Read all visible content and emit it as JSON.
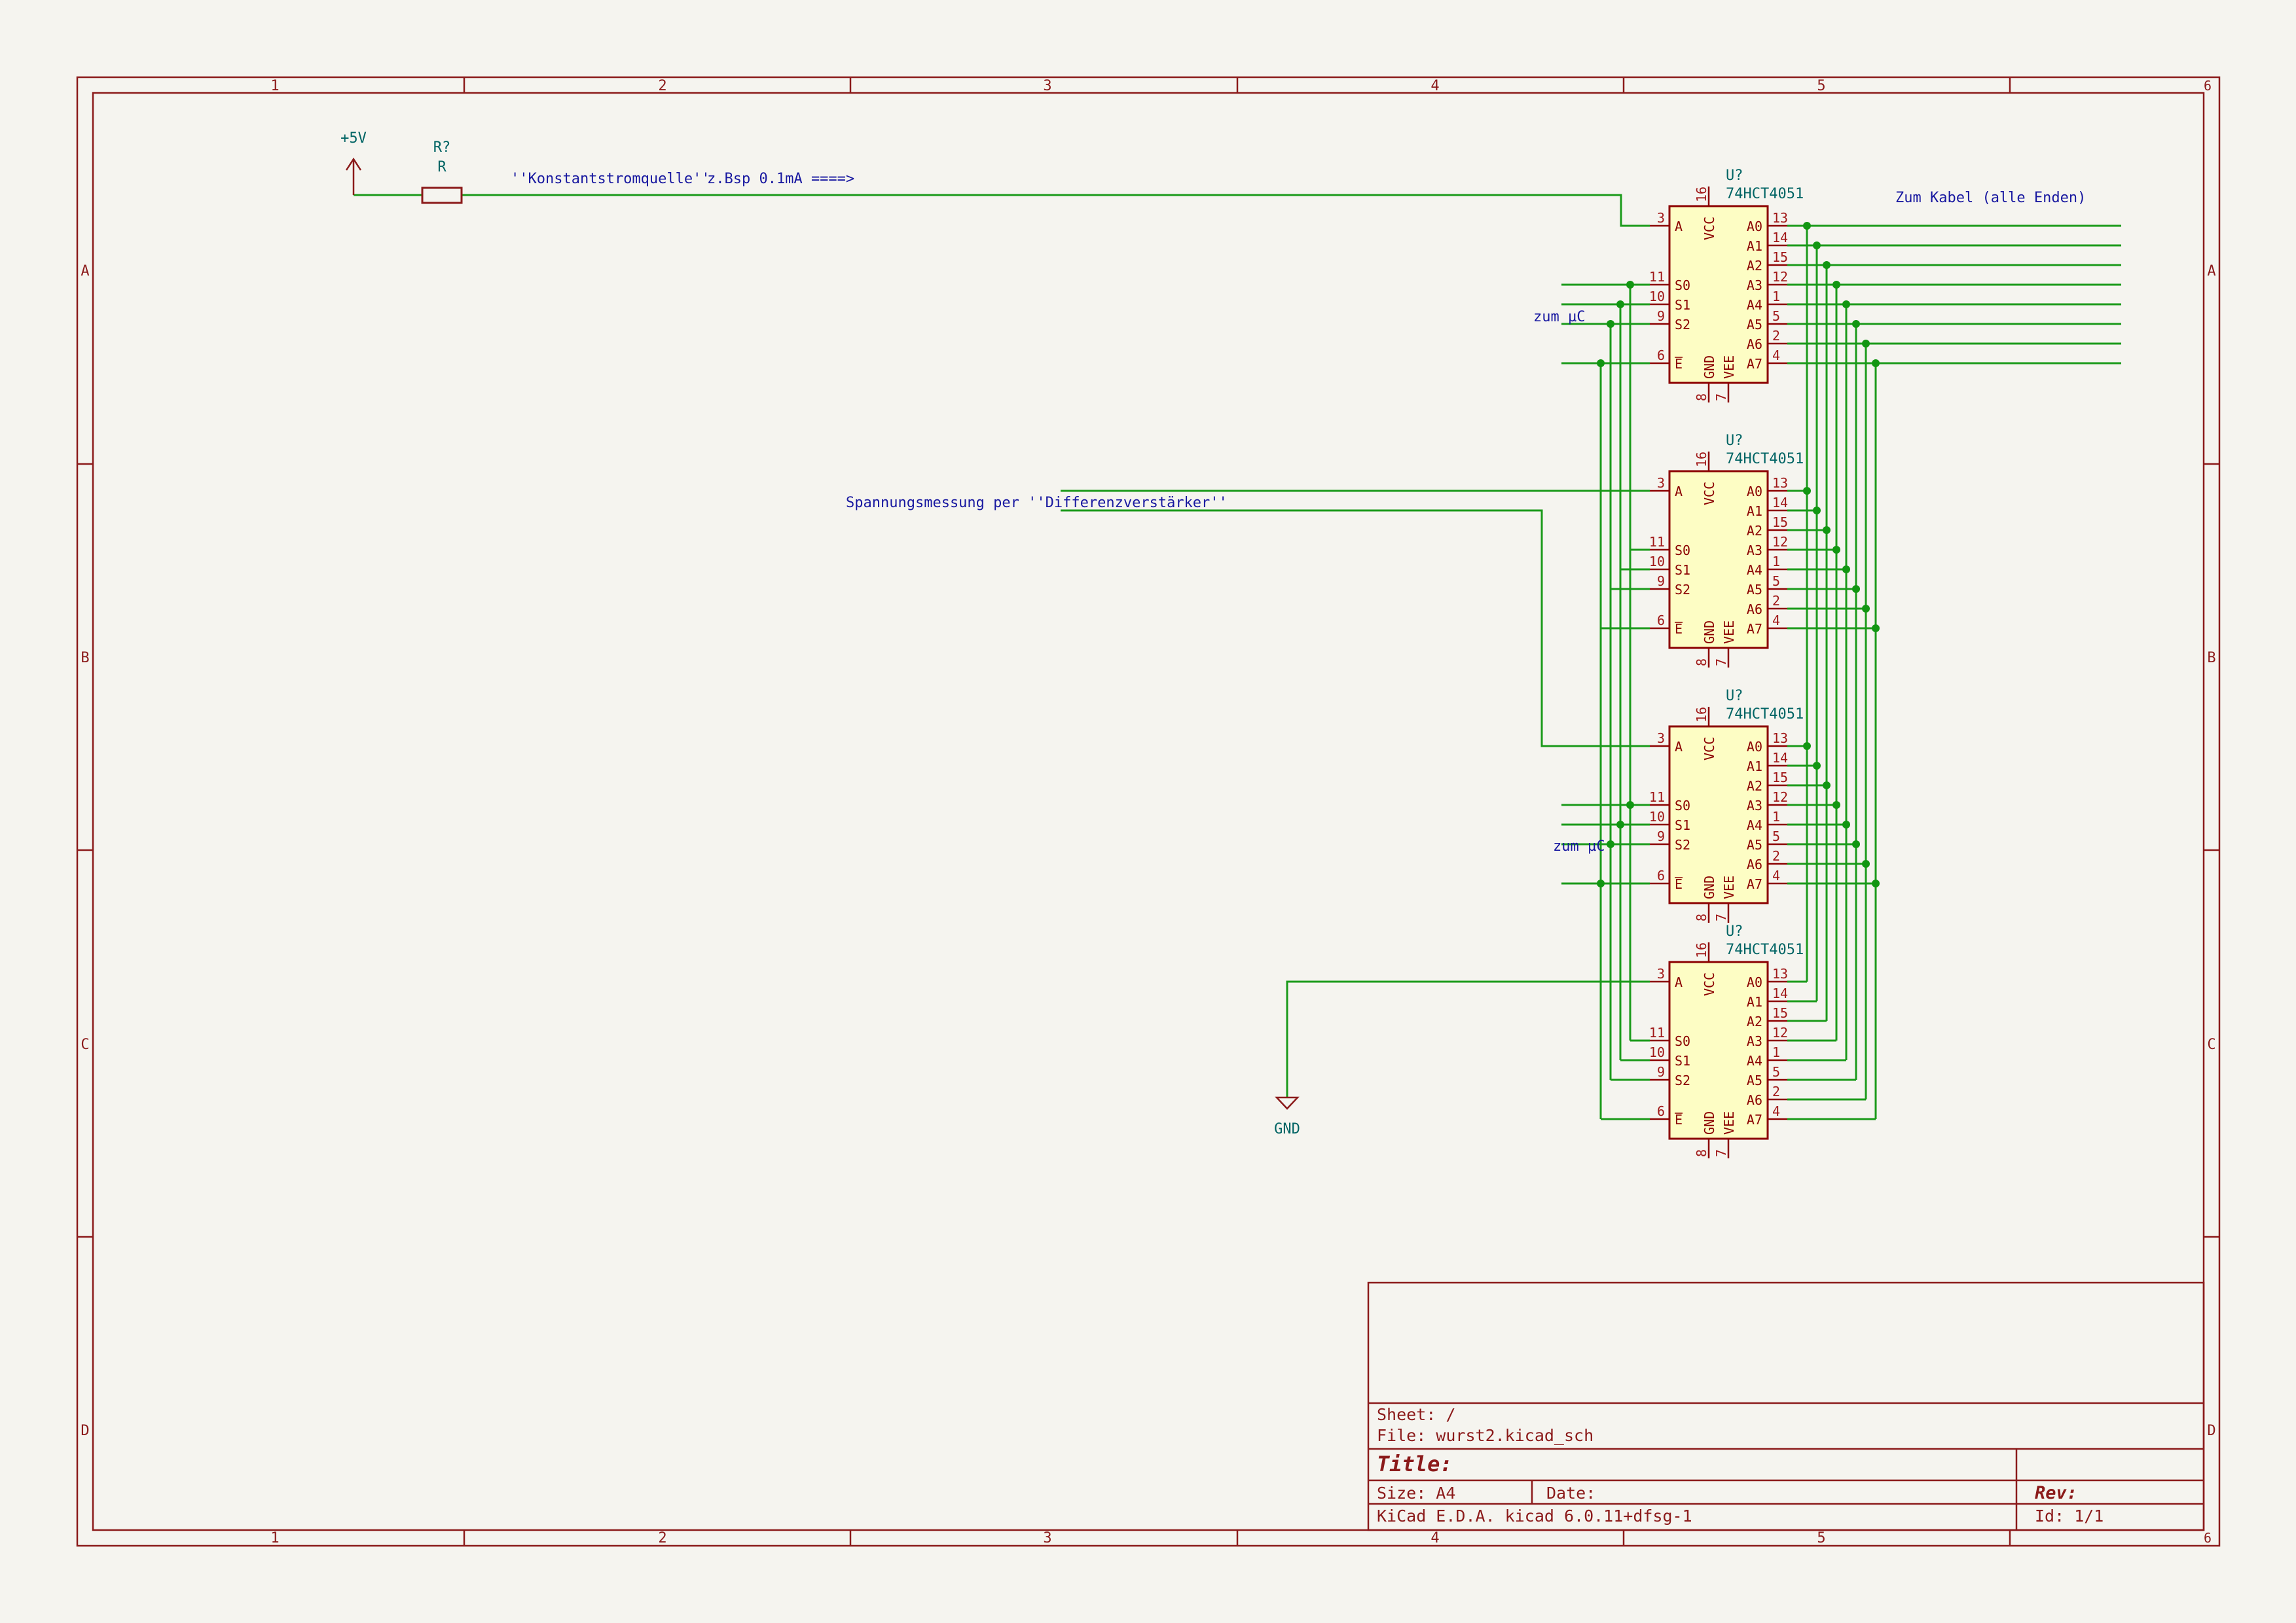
{
  "frame": {
    "columns": [
      "1",
      "2",
      "3",
      "4",
      "5",
      "6"
    ],
    "rows": [
      "A",
      "B",
      "C",
      "D"
    ]
  },
  "power": {
    "vcc_label": "+5V",
    "gnd_label": "GND"
  },
  "resistor": {
    "ref": "R?",
    "value": "R"
  },
  "labels": {
    "constant_current": "''Konstantstromquelle''",
    "example_current": "z.Bsp 0.1mA ====>",
    "to_cable": "Zum Kabel (alle Enden)",
    "to_uc": "zum µC",
    "voltage_measure": "Spannungsmessung per ''Differenzverstärker''"
  },
  "chip": {
    "ref": "U?",
    "part": "74HCT4051",
    "left_pins": [
      {
        "num": "3",
        "name": "A"
      },
      {
        "num": "11",
        "name": "S0"
      },
      {
        "num": "10",
        "name": "S1"
      },
      {
        "num": "9",
        "name": "S2"
      },
      {
        "num": "6",
        "name": "E"
      }
    ],
    "right_pins": [
      {
        "num": "13",
        "name": "A0"
      },
      {
        "num": "14",
        "name": "A1"
      },
      {
        "num": "15",
        "name": "A2"
      },
      {
        "num": "12",
        "name": "A3"
      },
      {
        "num": "1",
        "name": "A4"
      },
      {
        "num": "5",
        "name": "A5"
      },
      {
        "num": "2",
        "name": "A6"
      },
      {
        "num": "4",
        "name": "A7"
      }
    ],
    "top_pin": {
      "num": "16",
      "name": "VCC"
    },
    "bottom_pins": [
      {
        "num": "8",
        "name": "GND"
      },
      {
        "num": "7",
        "name": "VEE"
      }
    ]
  },
  "title_block": {
    "sheet": "Sheet: /",
    "file": "File: wurst2.kicad_sch",
    "title": "Title:",
    "size": "Size: A4",
    "date": "Date:",
    "rev": "Rev:",
    "tool": "KiCad E.D.A.  kicad 6.0.11+dfsg-1",
    "id": "Id: 1/1"
  },
  "colors": {
    "frame": "#8b1a1a",
    "wire": "#1a9a1a",
    "chip_fill": "#fdfdc4",
    "chip_border": "#8b0000",
    "pin_num": "#a01818",
    "pin_name": "#8b0000",
    "ref_text": "#006464",
    "label_text": "#1818a0",
    "junction": "#129612"
  }
}
